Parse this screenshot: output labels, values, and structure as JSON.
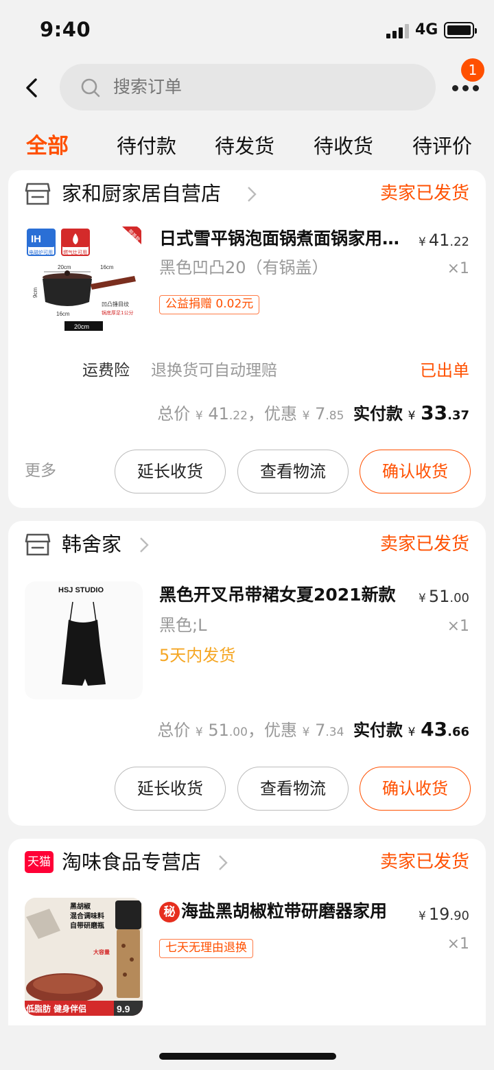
{
  "status_bar": {
    "time": "9:40",
    "network": "4G"
  },
  "search": {
    "placeholder": "搜索订单",
    "notification_count": "1"
  },
  "tabs": [
    {
      "label": "全部",
      "active": true
    },
    {
      "label": "待付款"
    },
    {
      "label": "待发货"
    },
    {
      "label": "待收货"
    },
    {
      "label": "待评价"
    }
  ],
  "orders": [
    {
      "shop_name": "家和厨家居自营店",
      "shop_icon": "store-icon",
      "status": "卖家已发货",
      "item": {
        "title": "日式雪平锅泡面锅煮面锅家用多功能",
        "price_yen": "¥",
        "price_int": "41",
        "price_dec": ".22",
        "sku": "黑色凹凸20（有锅盖）",
        "qty": "×1",
        "tag": "公益捐赠 0.02元",
        "image_texts": [
          "IH",
          "电磁炉可用",
          "燃气灶可用",
          "20cm",
          "16cm",
          "9cm",
          "16cm",
          "20cm",
          "凹凸锤目纹",
          "锅底厚足1公分",
          "带盖款"
        ]
      },
      "insurance": {
        "label": "运费险",
        "desc": "退换货可自动理赔",
        "status": "已出单"
      },
      "totals": {
        "total_label": "总价",
        "yen": "¥",
        "total_int": "41",
        "total_dec": ".22",
        "discount_label": "，优惠",
        "discount_int": "7",
        "discount_dec": ".85",
        "paid_label": "实付款",
        "paid_int": "33",
        "paid_dec": ".37"
      },
      "more_label": "更多",
      "buttons": [
        "延长收货",
        "查看物流",
        "确认收货"
      ]
    },
    {
      "shop_name": "韩舍家",
      "shop_icon": "store-icon",
      "status": "卖家已发货",
      "item": {
        "title": "黑色开叉吊带裙女夏2021新款",
        "price_yen": "¥",
        "price_int": "51",
        "price_dec": ".00",
        "sku": "黑色;L",
        "qty": "×1",
        "ship_note": "5天内发货",
        "image_texts": [
          "HSJ STUDIO"
        ]
      },
      "totals": {
        "total_label": "总价",
        "yen": "¥",
        "total_int": "51",
        "total_dec": ".00",
        "discount_label": "，优惠",
        "discount_int": "7",
        "discount_dec": ".34",
        "paid_label": "实付款",
        "paid_int": "43",
        "paid_dec": ".66"
      },
      "buttons": [
        "延长收货",
        "查看物流",
        "确认收货"
      ]
    },
    {
      "shop_name": "淘味食品专营店",
      "shop_icon": "tmall-icon",
      "shop_icon_text": "天猫",
      "status": "卖家已发货",
      "item": {
        "title_badge": "秘",
        "title": "海盐黑胡椒粒带研磨器家用",
        "price_yen": "¥",
        "price_int": "19",
        "price_dec": ".90",
        "qty": "×1",
        "tag": "七天无理由退换",
        "image_texts": [
          "黑胡椒",
          "混合调味料",
          "自带研磨瓶",
          "大容量",
          "低脂肪",
          "健身伴侣",
          "9.9"
        ]
      }
    }
  ],
  "colors": {
    "accent": "#ff5000",
    "ship_note": "#f5a623",
    "tmall": "#ff0036"
  }
}
